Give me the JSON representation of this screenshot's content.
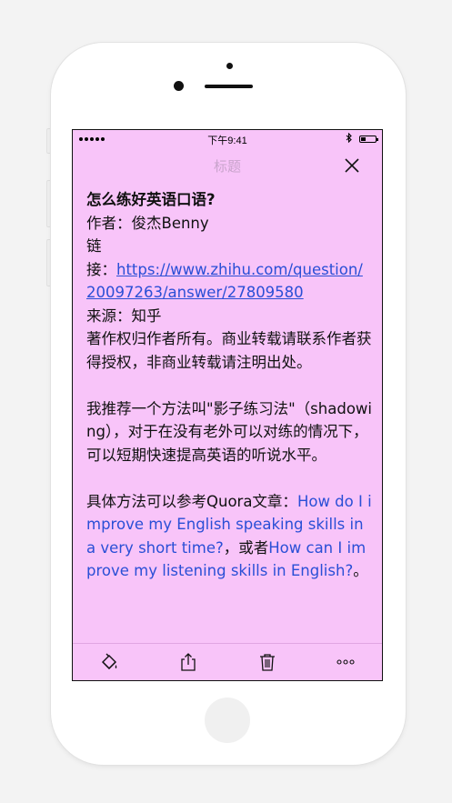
{
  "status_bar": {
    "time": "下午9:41",
    "battery_level": 0.35
  },
  "nav": {
    "title": "标题"
  },
  "note": {
    "title": "怎么练好英语口语?",
    "author": "作者：俊杰Benny",
    "link_label_1": "链",
    "link_label_2": "接：",
    "url": "https://www.zhihu.com/question/20097263/answer/27809580",
    "source": "来源：知乎",
    "copyright": "著作权归作者所有。商业转载请联系作者获得授权，非商业转载请注明出处。",
    "para1": "我推荐一个方法叫\"影子练习法\"（shadowing），对于在没有老外可以对练的情况下，可以短期快速提高英语的听说水平。",
    "para2_prefix": "具体方法可以参考Quora文章：",
    "link1": "How do I improve my English speaking skills in a very short time?",
    "para2_mid": "，或者",
    "link2": "How can I improve my listening skills in English?",
    "para2_suffix": "。"
  },
  "icons": {
    "paint": "paint-bucket-icon",
    "share": "share-icon",
    "trash": "trash-icon",
    "more": "more-icon",
    "close": "close-icon"
  },
  "colors": {
    "note_background": "#f8c4f9",
    "link": "#2a4fd6",
    "title_muted": "#c9a4cc"
  }
}
